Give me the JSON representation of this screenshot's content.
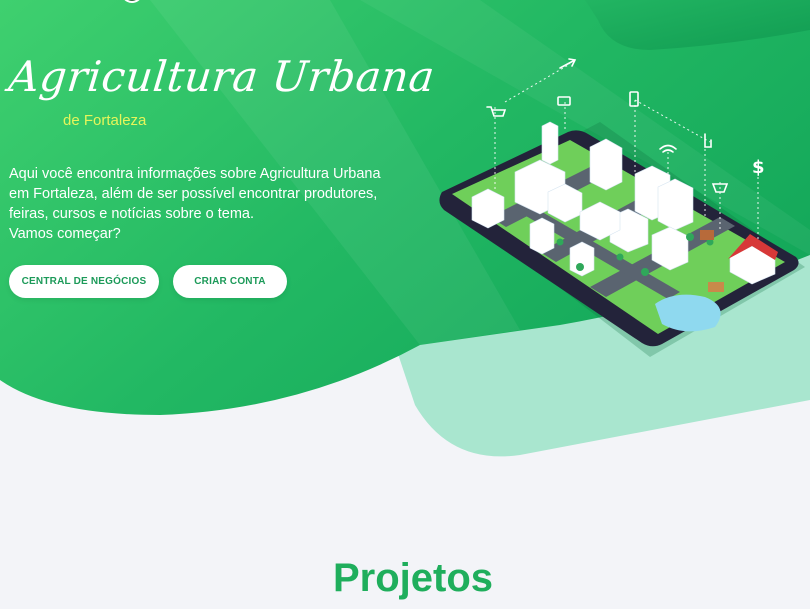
{
  "hero": {
    "title": "Agricultura Urbana",
    "subtitle": "de Fortaleza",
    "intro_lines": [
      "Aqui você encontra informações sobre Agricultura Urbana",
      "em Fortaleza, além de ser possível encontrar produtores,",
      "feiras, cursos e notícias sobre o tema.",
      "Vamos começar?"
    ],
    "buttons": {
      "central": "CENTRAL DE NEGÓCIOS",
      "criar": "CRIAR CONTA"
    },
    "illustration_icons": [
      "cart-icon",
      "chat-icon",
      "phone-icon",
      "hand-pointer-icon",
      "wifi-icon",
      "dollar-icon",
      "basket-icon",
      "arrow-up-right-icon"
    ]
  },
  "sections": {
    "projetos": "Projetos"
  },
  "colors": {
    "hero_green_light": "#3ccf73",
    "hero_green_dark": "#17a65a",
    "accent_yellow": "#e6f55a",
    "button_text": "#1c9a59",
    "section_title": "#1fae5c",
    "page_bg": "#f3f4f8"
  }
}
